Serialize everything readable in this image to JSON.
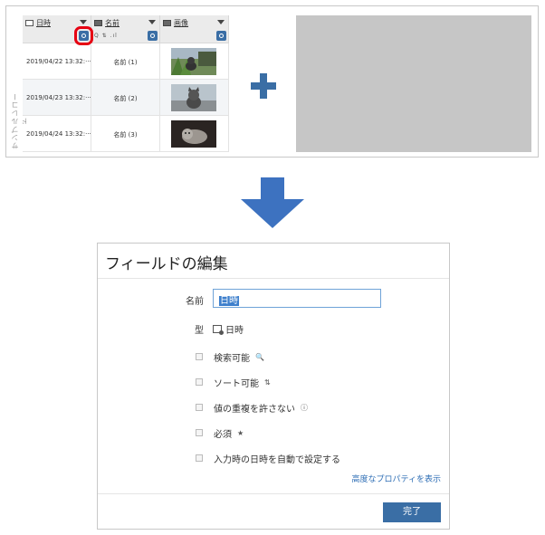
{
  "table": {
    "vertical_label": "サンプルレコード",
    "columns": [
      {
        "label": "日時",
        "sub": ""
      },
      {
        "label": "名前",
        "sub": "Q ⇅ .ıl"
      },
      {
        "label": "画像",
        "sub": ""
      }
    ],
    "rows": [
      {
        "date": "2019/04/22 13:32:···",
        "name": "名前 (1)"
      },
      {
        "date": "2019/04/23 13:32:···",
        "name": "名前 (2)"
      },
      {
        "date": "2019/04/24 13:32:···",
        "name": "名前 (3)"
      }
    ]
  },
  "dialog": {
    "title": "フィールドの編集",
    "name_label": "名前",
    "name_value": "日時",
    "type_label": "型",
    "type_value": "日時",
    "checkboxes": [
      {
        "label": "検索可能",
        "suffix": "🔍"
      },
      {
        "label": "ソート可能",
        "suffix": "⇅"
      },
      {
        "label": "値の重複を許さない",
        "suffix": "ⓘ"
      },
      {
        "label": "必須",
        "suffix": "★"
      },
      {
        "label": "入力時の日時を自動で設定する",
        "suffix": ""
      }
    ],
    "advanced_link": "高度なプロパティを表示",
    "done_button": "完了"
  },
  "colors": {
    "accent": "#3a6ea5",
    "highlight": "#e60012",
    "arrow": "#3d72c0"
  }
}
